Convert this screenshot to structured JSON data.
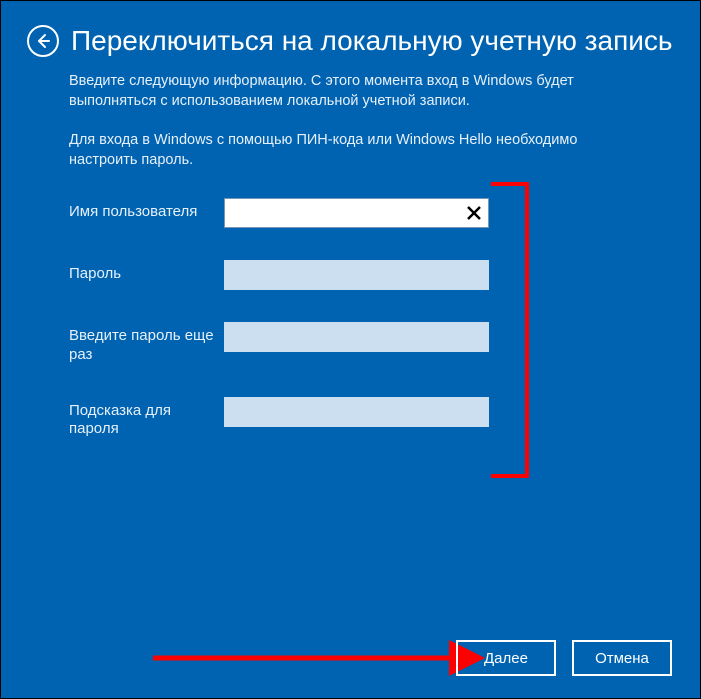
{
  "header": {
    "title": "Переключиться на локальную учетную запись"
  },
  "info": {
    "p1": "Введите следующую информацию. С этого момента вход в Windows будет выполняться с использованием локальной учетной записи.",
    "p2": "Для входа в Windows с помощью ПИН-кода или Windows Hello необходимо настроить пароль."
  },
  "form": {
    "username_label": "Имя пользователя",
    "username_value": "",
    "password_label": "Пароль",
    "password_value": "",
    "confirm_label": "Введите пароль еще раз",
    "confirm_value": "",
    "hint_label": "Подсказка для пароля",
    "hint_value": ""
  },
  "footer": {
    "next_label": "Далее",
    "cancel_label": "Отмена"
  },
  "colors": {
    "annotation": "#ff0000"
  }
}
